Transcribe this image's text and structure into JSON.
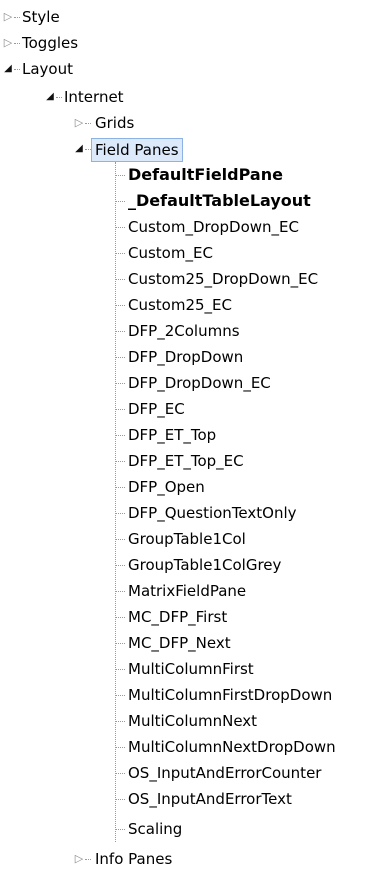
{
  "tree": {
    "root": [
      {
        "label": "Style",
        "expanded": false
      },
      {
        "label": "Toggles",
        "expanded": false
      },
      {
        "label": "Layout",
        "expanded": true
      }
    ],
    "internet": {
      "label": "Internet",
      "expanded": true
    },
    "grids": {
      "label": "Grids",
      "expanded": false
    },
    "field_panes": {
      "label": "Field Panes",
      "expanded": true,
      "selected": true
    },
    "field_pane_items": [
      {
        "label": "DefaultFieldPane",
        "bold": true
      },
      {
        "label": "_DefaultTableLayout",
        "bold": true
      },
      {
        "label": "Custom_DropDown_EC"
      },
      {
        "label": "Custom_EC"
      },
      {
        "label": "Custom25_DropDown_EC"
      },
      {
        "label": "Custom25_EC"
      },
      {
        "label": "DFP_2Columns"
      },
      {
        "label": "DFP_DropDown"
      },
      {
        "label": "DFP_DropDown_EC"
      },
      {
        "label": "DFP_EC"
      },
      {
        "label": "DFP_ET_Top"
      },
      {
        "label": "DFP_ET_Top_EC"
      },
      {
        "label": "DFP_Open"
      },
      {
        "label": "DFP_QuestionTextOnly"
      },
      {
        "label": "GroupTable1Col"
      },
      {
        "label": "GroupTable1ColGrey"
      },
      {
        "label": "MatrixFieldPane"
      },
      {
        "label": "MC_DFP_First"
      },
      {
        "label": "MC_DFP_Next"
      },
      {
        "label": "MultiColumnFirst"
      },
      {
        "label": "MultiColumnFirstDropDown"
      },
      {
        "label": "MultiColumnNext"
      },
      {
        "label": "MultiColumnNextDropDown"
      },
      {
        "label": "OS_InputAndErrorCounter"
      },
      {
        "label": "OS_InputAndErrorText"
      },
      {
        "label": "Scaling"
      }
    ],
    "info_panes": {
      "label": "Info Panes",
      "expanded": false
    }
  },
  "icons": {
    "expanded": "triangle-down-icon",
    "collapsed": "triangle-right-icon"
  },
  "colors": {
    "selection_bg": "#dbe9fb",
    "selection_border": "#8db2e3"
  }
}
